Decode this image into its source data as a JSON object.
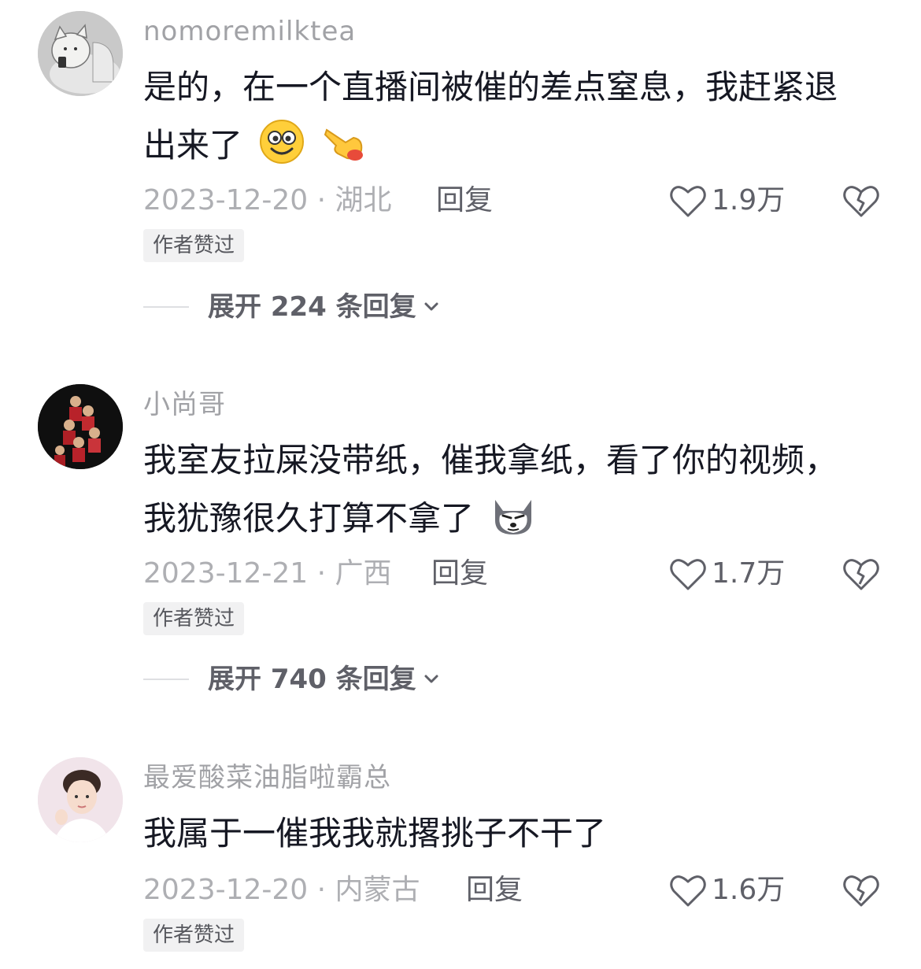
{
  "comments": [
    {
      "username": "nomoremilktea",
      "text_line1": "是的，在一个直播间被催的差点窒息，我赶紧退",
      "text_line2": "出来了",
      "emojis": [
        "smiling-face-icon",
        "pointing-hand-icon"
      ],
      "date_location": "2023-12-20 · 湖北",
      "reply_label": "回复",
      "likes": "1.9万",
      "badge": "作者赞过",
      "expand_label": "展开 224 条回复"
    },
    {
      "username": "小尚哥",
      "text_line1": "我室友拉屎没带纸，催我拿纸，看了你的视频，",
      "text_line2": "我犹豫很久打算不拿了",
      "emojis": [
        "husky-dog-icon"
      ],
      "date_location": "2023-12-21 · 广西",
      "reply_label": "回复",
      "likes": "1.7万",
      "badge": "作者赞过",
      "expand_label": "展开 740 条回复"
    },
    {
      "username": "最爱酸菜油脂啦霸总",
      "text_line1": "我属于一催我我就撂挑子不干了",
      "date_location": "2023-12-20 · 内蒙古",
      "reply_label": "回复",
      "likes": "1.6万",
      "badge": "作者赞过"
    }
  ],
  "colors": {
    "username": "#a1a2a6",
    "text": "#161823",
    "meta": "#aeafb3",
    "badge_bg": "#f1f1f2"
  }
}
